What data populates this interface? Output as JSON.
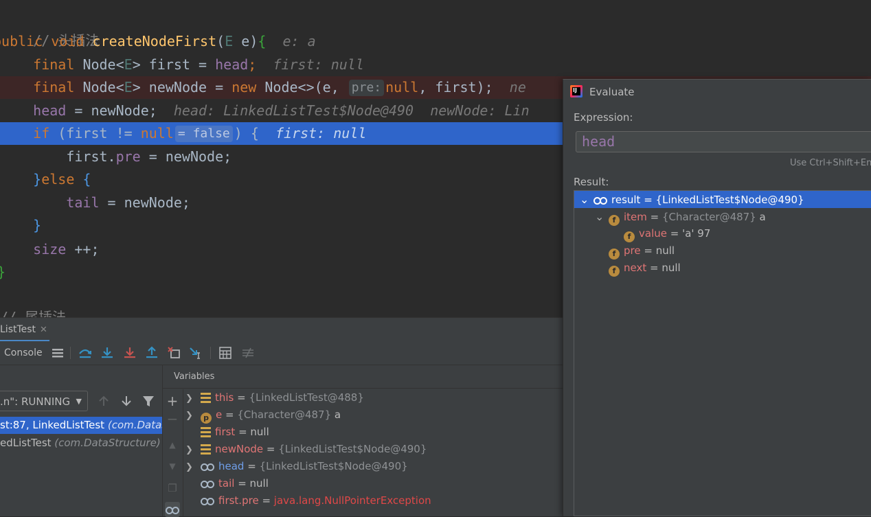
{
  "editor": {
    "comment_top": "// 头插法",
    "sig_kw1": "public",
    "sig_kw2": "void",
    "sig_fn": "createNodeFirst",
    "sig_param_type": "E",
    "sig_param": "e",
    "sig_hint": "e: a",
    "l1_kw": "final",
    "l1_type": "Node<",
    "l1_tparam": "E",
    "l1_rest": "> first = ",
    "l1_field": "head",
    "l1_hint": "first: null",
    "l2_kw": "final",
    "l2_type": "Node<",
    "l2_tparam": "E",
    "l2_rest": "> newNode = ",
    "l2_new": "new",
    "l2_ctor": " Node<>(e, ",
    "l2_pill": "pre:",
    "l2_null": "null",
    "l2_tail": ", first);",
    "l2_hint": "ne",
    "l3_field": "head",
    "l3_rest": " = newNode;",
    "l3_hint1": "head: LinkedListTest$Node@490",
    "l3_hint2": "newNode: Lin",
    "l4_kw": "if",
    "l4_cond": " (first != ",
    "l4_null": "null",
    "l4_pill": "= false",
    "l4_close": ") {",
    "l4_hint": "first: null",
    "l5_a": "first.",
    "l5_field": "pre",
    "l5_b": " = newNode;",
    "l6_close": "}",
    "l6_else": "else",
    "l6_open": " {",
    "l7_field": "tail",
    "l7_rest": " = newNode;",
    "l8": "}",
    "l9_field": "size",
    "l9_rest": " ++;",
    "l10": "}",
    "comment_bottom": "// 尾插法"
  },
  "debug": {
    "tab_label": "ListTest",
    "tab_close": "✕",
    "console_label": "Console",
    "thread_select": ".n\": RUNNING",
    "frames": [
      {
        "text": "st:87, LinkedListTest ",
        "pkg": "(com.DataS"
      },
      {
        "text": "edListTest ",
        "pkg": "(com.DataStructure)"
      }
    ],
    "variables_label": "Variables",
    "variables": [
      {
        "icon": "lines",
        "name": "this",
        "eq": " = ",
        "gray": "{LinkedListTest@488}",
        "val": ""
      },
      {
        "icon": "p",
        "name": "e",
        "eq": " = ",
        "gray": "{Character@487}",
        "val": " a"
      },
      {
        "icon": "lines",
        "name": "first",
        "eq": " = ",
        "gray": "",
        "val": "null"
      },
      {
        "icon": "lines",
        "name": "newNode",
        "eq": " = ",
        "gray": "{LinkedListTest$Node@490}",
        "val": ""
      },
      {
        "icon": "oo",
        "name": "head",
        "eq": " = ",
        "gray": "{LinkedListTest$Node@490}",
        "val": ""
      },
      {
        "icon": "oo",
        "name": "tail",
        "eq": " = ",
        "gray": "",
        "val": "null"
      },
      {
        "icon": "oo",
        "name": "first.pre",
        "eq": " = ",
        "gray": "",
        "val": "java.lang.NullPointerException"
      }
    ]
  },
  "evaluate": {
    "title": "Evaluate",
    "logo_text": "IJ",
    "expression_label": "Expression:",
    "expression_value": "head",
    "hint": "Use Ctrl+Shift+Ent",
    "result_label": "Result:",
    "tree": [
      {
        "icon": "oo",
        "name": "result",
        "eq": " = ",
        "gray": "",
        "val": "{LinkedListTest$Node@490}"
      },
      {
        "icon": "f",
        "name": "item",
        "eq": " = ",
        "gray": "{Character@487}",
        "val": " a"
      },
      {
        "icon": "f",
        "name": "value",
        "eq": " = ",
        "gray": "",
        "val": "'a' 97"
      },
      {
        "icon": "f",
        "name": "pre",
        "eq": " = ",
        "gray": "",
        "val": "null"
      },
      {
        "icon": "f",
        "name": "next",
        "eq": " = ",
        "gray": "",
        "val": "null"
      }
    ]
  }
}
